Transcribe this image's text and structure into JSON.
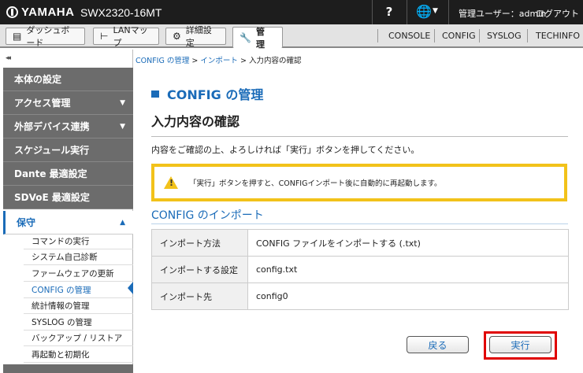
{
  "header": {
    "brand": "YAMAHA",
    "model": "SWX2320-16MT",
    "help_label": "?",
    "user_label": "管理ユーザー：admin",
    "logout_label": "ログアウト"
  },
  "tabs": [
    {
      "label": "ダッシュボード",
      "icon": "dashboard-icon"
    },
    {
      "label": "LANマップ",
      "icon": "lan-map-icon"
    },
    {
      "label": "詳細設定",
      "icon": "gear-icon"
    },
    {
      "label": "管 理",
      "icon": "wrench-icon"
    }
  ],
  "right_links": [
    "CONSOLE",
    "CONFIG",
    "SYSLOG",
    "TECHINFO"
  ],
  "sidebar": {
    "collapse_label": "◂◂",
    "items": [
      {
        "label": "本体の設定"
      },
      {
        "label": "アクセス管理",
        "caret": "▼"
      },
      {
        "label": "外部デバイス連携",
        "caret": "▼"
      },
      {
        "label": "スケジュール実行"
      },
      {
        "label": "Dante 最適設定"
      },
      {
        "label": "SDVoE 最適設定"
      },
      {
        "label": "保守",
        "caret": "▲"
      }
    ],
    "subitems": [
      "コマンドの実行",
      "システム自己診断",
      "ファームウェアの更新",
      "CONFIG の管理",
      "統計情報の管理",
      "SYSLOG の管理",
      "バックアップ / リストア",
      "再起動と初期化"
    ]
  },
  "breadcrumb": {
    "items": [
      "CONFIG の管理",
      "インポート",
      "入力内容の確認"
    ],
    "separator": ">"
  },
  "main": {
    "title": "CONFIG の管理",
    "subtitle": "入力内容の確認",
    "description": "内容をご確認の上、よろしければ「実行」ボタンを押してください。",
    "warning": "「実行」ボタンを押すと、CONFIGインポート後に自動的に再起動します。",
    "section_title": "CONFIG のインポート",
    "rows": [
      {
        "key": "インポート方法",
        "value": "CONFIG ファイルをインポートする (.txt)"
      },
      {
        "key": "インポートする設定",
        "value": "config.txt"
      },
      {
        "key": "インポート先",
        "value": "config0"
      }
    ],
    "back_label": "戻る",
    "execute_label": "実行"
  },
  "colors": {
    "accent": "#1a6bb8",
    "warning": "#f2c21a",
    "highlight": "#e00000",
    "topbar": "#1d1d1d"
  }
}
